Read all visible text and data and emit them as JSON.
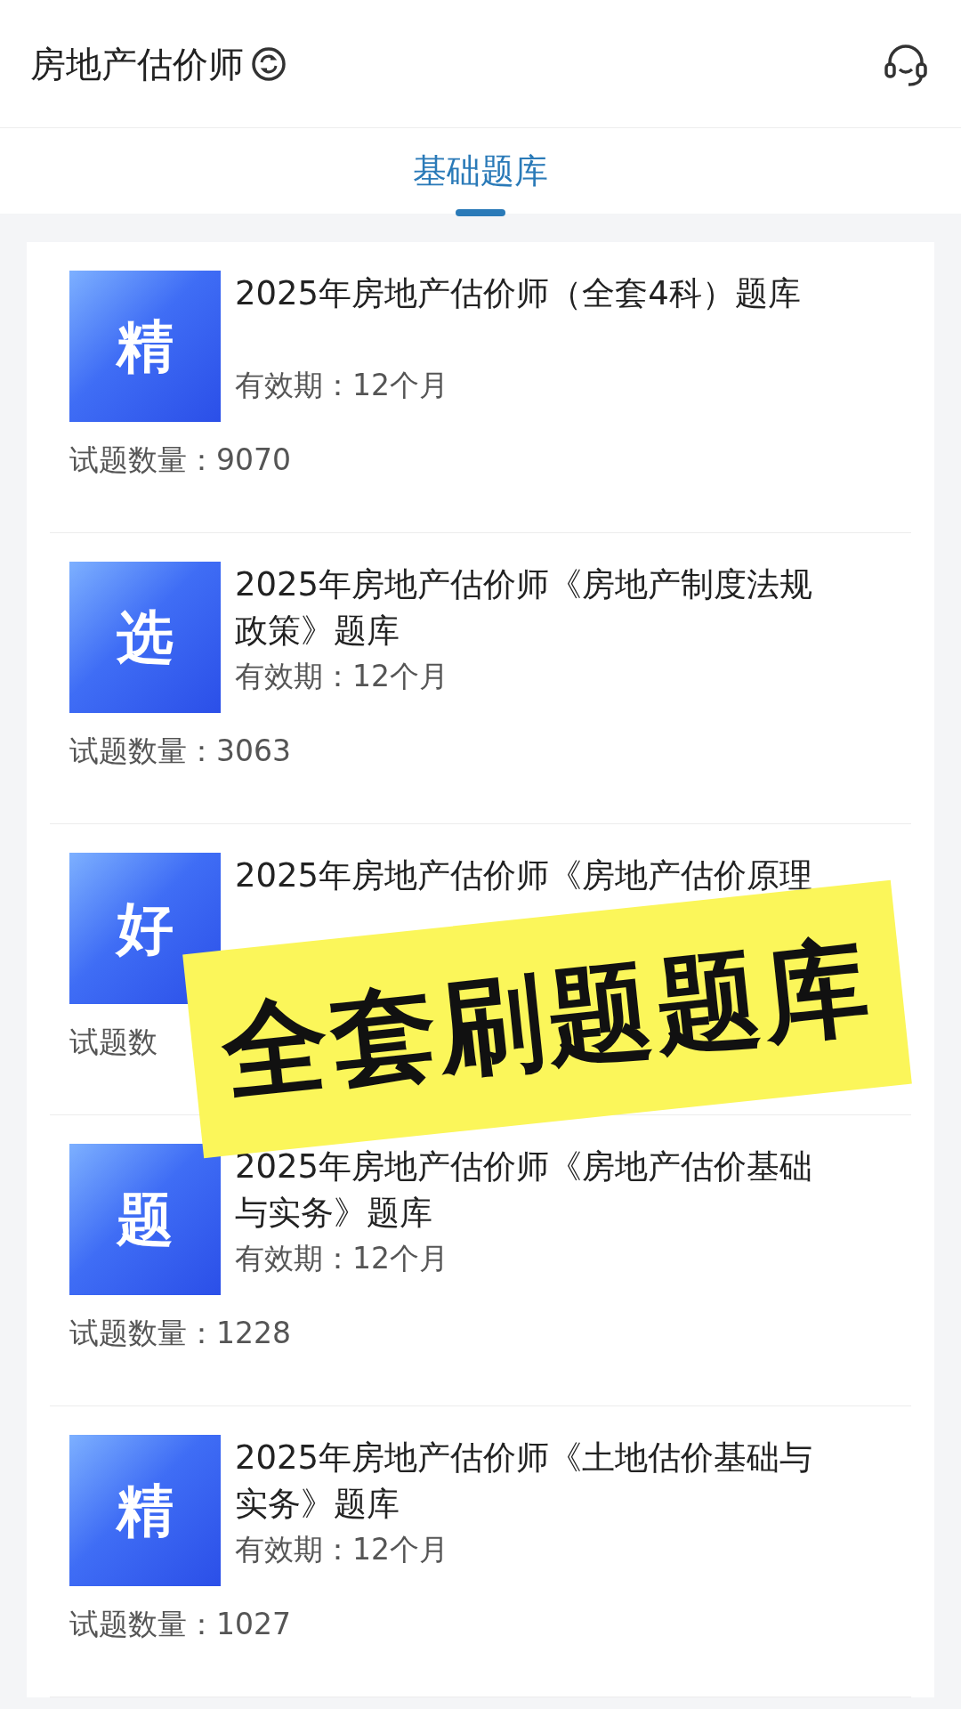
{
  "header": {
    "title": "房地产估价师"
  },
  "tabs": [
    {
      "label": "基础题库",
      "selected": true
    }
  ],
  "banks": [
    {
      "badge": "精",
      "title": "2025年房地产估价师（全套4科）题库",
      "validity": "有效期：12个月",
      "count_label": "试题数量：",
      "count": "9070"
    },
    {
      "badge": "选",
      "title": "2025年房地产估价师《房地产制度法规政策》题库",
      "validity": "有效期：12个月",
      "count_label": "试题数量：",
      "count": "3063"
    },
    {
      "badge": "好",
      "title": "2025年房地产估价师《房地产估价原理",
      "count_label": "试题数"
    },
    {
      "badge": "题",
      "title": "2025年房地产估价师《房地产估价基础与实务》题库",
      "validity": "有效期：12个月",
      "count_label": "试题数量：",
      "count": "1228"
    },
    {
      "badge": "精",
      "title": "2025年房地产估价师《土地估价基础与实务》题库",
      "validity": "有效期：12个月",
      "count_label": "试题数量：",
      "count": "1027"
    }
  ],
  "sticker": {
    "text": "全套刷题题库"
  }
}
